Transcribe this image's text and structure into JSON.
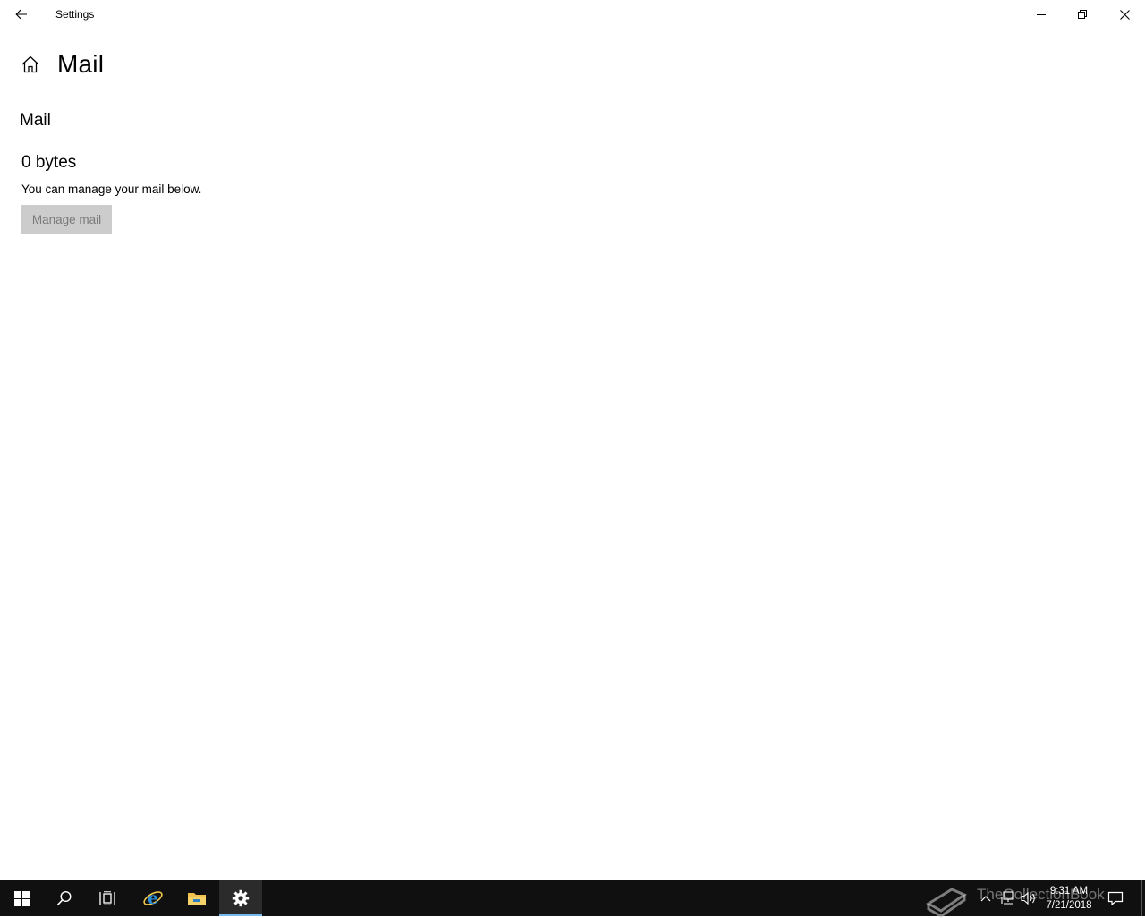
{
  "window": {
    "title": "Settings"
  },
  "page": {
    "title": "Mail",
    "section_title": "Mail",
    "size_value": "0 bytes",
    "description": "You can manage your mail below.",
    "manage_button_label": "Manage mail"
  },
  "taskbar": {
    "items": [
      "start-icon",
      "search-icon",
      "task-view-icon",
      "internet-explorer-icon",
      "file-explorer-icon",
      "settings-icon"
    ],
    "active_item": "settings-icon",
    "clock_time": "9:31 AM",
    "clock_date": "7/21/2018",
    "watermark": "TheCollectionBook",
    "accent": "#76b9ed"
  },
  "colors": {
    "button_disabled_bg": "#cccccc",
    "taskbar_bg": "#101010"
  }
}
